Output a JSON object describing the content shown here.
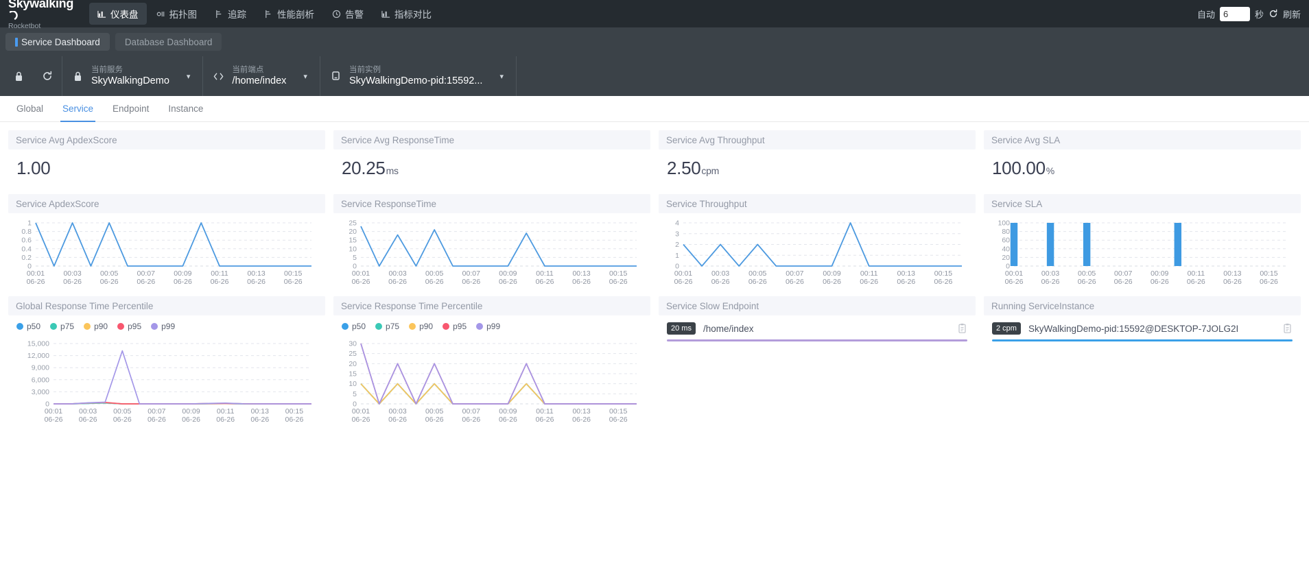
{
  "header": {
    "brand": "Skywalking",
    "brand_sub": "Rocketbot",
    "nav": [
      {
        "label": "仪表盘",
        "icon": "dashboard-icon",
        "active": true
      },
      {
        "label": "拓扑图",
        "icon": "topology-icon",
        "active": false
      },
      {
        "label": "追踪",
        "icon": "trace-icon",
        "active": false
      },
      {
        "label": "性能剖析",
        "icon": "profile-icon",
        "active": false
      },
      {
        "label": "告警",
        "icon": "alarm-icon",
        "active": false
      },
      {
        "label": "指标对比",
        "icon": "compare-icon",
        "active": false
      }
    ],
    "auto_label": "自动",
    "auto_value": "6",
    "seconds_label": "秒",
    "refresh_label": "刷新",
    "refresh_icon": "refresh-icon"
  },
  "dashboard_tabs": [
    {
      "label": "Service Dashboard",
      "selected": true
    },
    {
      "label": "Database Dashboard",
      "selected": false
    }
  ],
  "selectors": {
    "lock_icon": "lock-icon",
    "reload_icon": "reload-icon",
    "items": [
      {
        "icon": "service-icon",
        "label": "当前服务",
        "value": "SkyWalkingDemo"
      },
      {
        "icon": "endpoint-icon",
        "label": "当前端点",
        "value": "/home/index"
      },
      {
        "icon": "instance-icon",
        "label": "当前实例",
        "value": "SkyWalkingDemo-pid:15592..."
      }
    ]
  },
  "subtabs": [
    {
      "label": "Global",
      "active": false
    },
    {
      "label": "Service",
      "active": true
    },
    {
      "label": "Endpoint",
      "active": false
    },
    {
      "label": "Instance",
      "active": false
    }
  ],
  "summary": [
    {
      "title": "Service Avg ApdexScore",
      "value": "1.00",
      "unit": ""
    },
    {
      "title": "Service Avg ResponseTime",
      "value": "20.25",
      "unit": "ms"
    },
    {
      "title": "Service Avg Throughput",
      "value": "2.50",
      "unit": "cpm"
    },
    {
      "title": "Service Avg SLA",
      "value": "100.00",
      "unit": "%"
    }
  ],
  "panels": {
    "apdex": {
      "title": "Service ApdexScore"
    },
    "resptime": {
      "title": "Service ResponseTime"
    },
    "throughput": {
      "title": "Service Throughput"
    },
    "sla": {
      "title": "Service SLA"
    },
    "global_pct": {
      "title": "Global Response Time Percentile"
    },
    "service_pct": {
      "title": "Service Response Time Percentile"
    },
    "slow_endpoint": {
      "title": "Service Slow Endpoint"
    },
    "running_instance": {
      "title": "Running ServiceInstance"
    }
  },
  "percentile_legend": [
    {
      "label": "p50",
      "color": "#3aa0e8"
    },
    {
      "label": "p75",
      "color": "#3ac9b6"
    },
    {
      "label": "p90",
      "color": "#fbc55b"
    },
    {
      "label": "p95",
      "color": "#f8576f"
    },
    {
      "label": "p99",
      "color": "#a497e8"
    }
  ],
  "slow_endpoint_list": [
    {
      "badge": "20 ms",
      "name": "/home/index",
      "bar_color": "#b39ddb",
      "bar_pct": 100,
      "copy_icon": "clipboard-icon"
    }
  ],
  "running_instance_list": [
    {
      "badge": "2 cpm",
      "name": "SkyWalkingDemo-pid:15592@DESKTOP-7JOLG2I",
      "bar_color": "#3aa0e8",
      "bar_pct": 100,
      "copy_icon": "clipboard-icon"
    }
  ],
  "chart_data": [
    {
      "type": "line",
      "title": "Service ApdexScore",
      "x": [
        "00:01",
        "00:02",
        "00:03",
        "00:04",
        "00:05",
        "00:06",
        "00:07",
        "00:08",
        "00:09",
        "00:10",
        "00:11",
        "00:12",
        "00:13",
        "00:14",
        "00:15",
        "00:16"
      ],
      "tick_labels": [
        "00:01",
        "00:03",
        "00:05",
        "00:07",
        "00:09",
        "00:11",
        "00:13",
        "00:15"
      ],
      "tick_dates": [
        "06-26",
        "06-26",
        "06-26",
        "06-26",
        "06-26",
        "06-26",
        "06-26",
        "06-26"
      ],
      "values": [
        1,
        0,
        1,
        0,
        1,
        0,
        0,
        0,
        0,
        1,
        0,
        0,
        0,
        0,
        0,
        0
      ],
      "yticks": [
        0,
        0.2,
        0.4,
        0.6,
        0.8,
        1
      ],
      "ylim": [
        0,
        1
      ],
      "xlabel": "",
      "ylabel": "",
      "grid": true,
      "legend": "none",
      "color": "#4d9ae0"
    },
    {
      "type": "line",
      "title": "Service ResponseTime",
      "x": [
        "00:01",
        "00:02",
        "00:03",
        "00:04",
        "00:05",
        "00:06",
        "00:07",
        "00:08",
        "00:09",
        "00:10",
        "00:11",
        "00:12",
        "00:13",
        "00:14",
        "00:15",
        "00:16"
      ],
      "tick_labels": [
        "00:01",
        "00:03",
        "00:05",
        "00:07",
        "00:09",
        "00:11",
        "00:13",
        "00:15"
      ],
      "tick_dates": [
        "06-26",
        "06-26",
        "06-26",
        "06-26",
        "06-26",
        "06-26",
        "06-26",
        "06-26"
      ],
      "values": [
        23,
        0,
        18,
        0,
        21,
        0,
        0,
        0,
        0,
        19,
        0,
        0,
        0,
        0,
        0,
        0
      ],
      "yticks": [
        0,
        5,
        10,
        15,
        20,
        25
      ],
      "ylim": [
        0,
        25
      ],
      "xlabel": "",
      "ylabel": "",
      "grid": true,
      "legend": "none",
      "color": "#4d9ae0"
    },
    {
      "type": "line",
      "title": "Service Throughput",
      "x": [
        "00:01",
        "00:02",
        "00:03",
        "00:04",
        "00:05",
        "00:06",
        "00:07",
        "00:08",
        "00:09",
        "00:10",
        "00:11",
        "00:12",
        "00:13",
        "00:14",
        "00:15",
        "00:16"
      ],
      "tick_labels": [
        "00:01",
        "00:03",
        "00:05",
        "00:07",
        "00:09",
        "00:11",
        "00:13",
        "00:15"
      ],
      "tick_dates": [
        "06-26",
        "06-26",
        "06-26",
        "06-26",
        "06-26",
        "06-26",
        "06-26",
        "06-26"
      ],
      "values": [
        2,
        0,
        2,
        0,
        2,
        0,
        0,
        0,
        0,
        4,
        0,
        0,
        0,
        0,
        0,
        0
      ],
      "yticks": [
        0,
        1,
        2,
        3,
        4
      ],
      "ylim": [
        0,
        4
      ],
      "xlabel": "",
      "ylabel": "",
      "grid": true,
      "legend": "none",
      "color": "#4d9ae0"
    },
    {
      "type": "bar",
      "title": "Service SLA",
      "x": [
        "00:01",
        "00:02",
        "00:03",
        "00:04",
        "00:05",
        "00:06",
        "00:07",
        "00:08",
        "00:09",
        "00:10",
        "00:11",
        "00:12",
        "00:13",
        "00:14",
        "00:15",
        "00:16"
      ],
      "tick_labels": [
        "00:01",
        "00:03",
        "00:05",
        "00:07",
        "00:09",
        "00:11",
        "00:13",
        "00:15"
      ],
      "tick_dates": [
        "06-26",
        "06-26",
        "06-26",
        "06-26",
        "06-26",
        "06-26",
        "06-26",
        "06-26"
      ],
      "values": [
        100,
        0,
        100,
        0,
        100,
        0,
        0,
        0,
        0,
        100,
        0,
        0,
        0,
        0,
        0,
        0
      ],
      "yticks": [
        0,
        20,
        40,
        60,
        80,
        100
      ],
      "ylim": [
        0,
        100
      ],
      "xlabel": "",
      "ylabel": "",
      "grid": true,
      "legend": "none",
      "color": "#3e9ae2"
    },
    {
      "type": "line",
      "title": "Global Response Time Percentile",
      "x": [
        "00:01",
        "00:02",
        "00:03",
        "00:04",
        "00:05",
        "00:06",
        "00:07",
        "00:08",
        "00:09",
        "00:10",
        "00:11",
        "00:12",
        "00:13",
        "00:14",
        "00:15",
        "00:16"
      ],
      "tick_labels": [
        "00:01",
        "00:03",
        "00:05",
        "00:07",
        "00:09",
        "00:11",
        "00:13",
        "00:15"
      ],
      "tick_dates": [
        "06-26",
        "06-26",
        "06-26",
        "06-26",
        "06-26",
        "06-26",
        "06-26",
        "06-26"
      ],
      "yticks": [
        0,
        3000,
        6000,
        9000,
        12000,
        15000
      ],
      "ytick_labels": [
        "0",
        "3,000",
        "6,000",
        "9,000",
        "12,000",
        "15,000"
      ],
      "ylim": [
        0,
        15000
      ],
      "grid": true,
      "legend": "top-left",
      "series": [
        {
          "name": "p50",
          "color": "#3aa0e8",
          "values": [
            0,
            0,
            100,
            200,
            0,
            0,
            0,
            0,
            0,
            30,
            60,
            20,
            0,
            0,
            0,
            0
          ]
        },
        {
          "name": "p75",
          "color": "#3ac9b6",
          "values": [
            0,
            0,
            120,
            250,
            0,
            0,
            0,
            0,
            0,
            40,
            70,
            25,
            0,
            0,
            0,
            0
          ]
        },
        {
          "name": "p90",
          "color": "#fbc55b",
          "values": [
            0,
            0,
            180,
            320,
            0,
            0,
            0,
            0,
            0,
            60,
            90,
            30,
            0,
            0,
            0,
            0
          ]
        },
        {
          "name": "p95",
          "color": "#f8576f",
          "values": [
            0,
            0,
            220,
            380,
            0,
            0,
            0,
            0,
            0,
            80,
            110,
            35,
            0,
            0,
            0,
            0
          ]
        },
        {
          "name": "p99",
          "color": "#a497e8",
          "values": [
            0,
            0,
            260,
            420,
            13200,
            0,
            0,
            0,
            0,
            120,
            200,
            40,
            0,
            0,
            0,
            0
          ]
        }
      ]
    },
    {
      "type": "line",
      "title": "Service Response Time Percentile",
      "x": [
        "00:01",
        "00:02",
        "00:03",
        "00:04",
        "00:05",
        "00:06",
        "00:07",
        "00:08",
        "00:09",
        "00:10",
        "00:11",
        "00:12",
        "00:13",
        "00:14",
        "00:15",
        "00:16"
      ],
      "tick_labels": [
        "00:01",
        "00:03",
        "00:05",
        "00:07",
        "00:09",
        "00:11",
        "00:13",
        "00:15"
      ],
      "tick_dates": [
        "06-26",
        "06-26",
        "06-26",
        "06-26",
        "06-26",
        "06-26",
        "06-26",
        "06-26"
      ],
      "yticks": [
        0,
        5,
        10,
        15,
        20,
        25,
        30
      ],
      "ylim": [
        0,
        30
      ],
      "grid": true,
      "legend": "top-left",
      "series": [
        {
          "name": "p50",
          "color": "#3aa0e8",
          "values": [
            10,
            0,
            10,
            0,
            10,
            0,
            0,
            0,
            0,
            10,
            0,
            0,
            0,
            0,
            0,
            0
          ]
        },
        {
          "name": "p75",
          "color": "#3ac9b6",
          "values": [
            10,
            0,
            10,
            0,
            10,
            0,
            0,
            0,
            0,
            10,
            0,
            0,
            0,
            0,
            0,
            0
          ]
        },
        {
          "name": "p90",
          "color": "#fbc55b",
          "values": [
            10,
            0,
            10,
            0,
            10,
            0,
            0,
            0,
            0,
            10,
            0,
            0,
            0,
            0,
            0,
            0
          ]
        },
        {
          "name": "p95",
          "color": "#f8576f",
          "values": [
            30,
            0,
            20,
            0,
            20,
            0,
            0,
            0,
            0,
            20,
            0,
            0,
            0,
            0,
            0,
            0
          ]
        },
        {
          "name": "p99",
          "color": "#a497e8",
          "values": [
            30,
            0,
            20,
            0,
            20,
            0,
            0,
            0,
            0,
            20,
            0,
            0,
            0,
            0,
            0,
            0
          ]
        }
      ]
    }
  ]
}
